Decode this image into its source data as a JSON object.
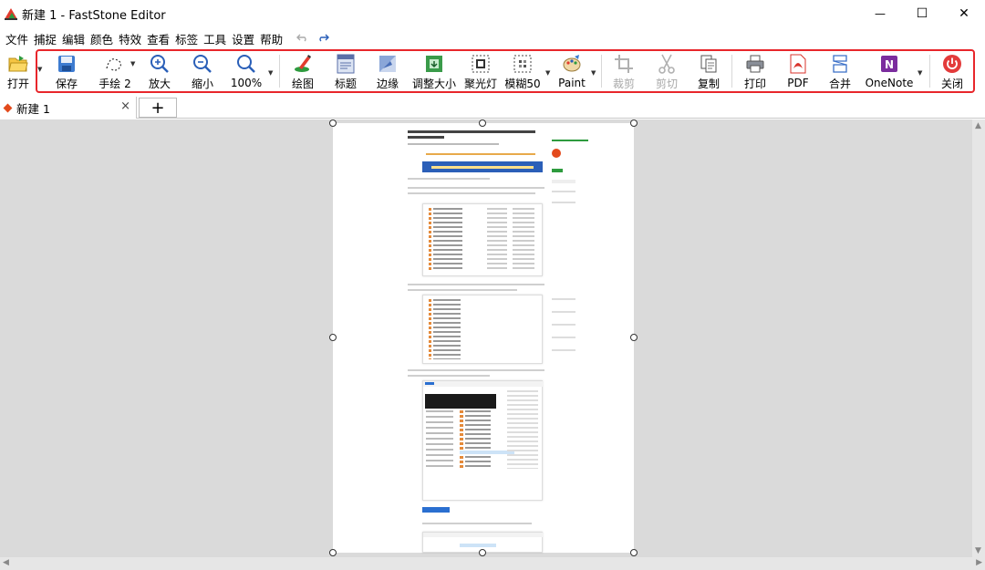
{
  "window": {
    "title": "新建 1 - FastStone Editor",
    "minimize_glyph": "—",
    "maximize_glyph": "☐",
    "close_glyph": "✕"
  },
  "menu": [
    "文件",
    "捕捉",
    "编辑",
    "颜色",
    "特效",
    "查看",
    "标签",
    "工具",
    "设置",
    "帮助"
  ],
  "toolbar": {
    "open": "打开",
    "save": "保存",
    "freehand": "手绘 2",
    "zoom_in": "放大",
    "zoom_out": "缩小",
    "zoom_level": "100%",
    "draw": "绘图",
    "caption": "标题",
    "edge": "边缘",
    "resize": "调整大小",
    "spotlight": "聚光灯",
    "blur": "模糊50",
    "paint": "Paint",
    "crop": "裁剪",
    "cut": "剪切",
    "copy": "复制",
    "print": "打印",
    "pdf": "PDF",
    "merge": "合并",
    "onenote": "OneNote",
    "close": "关闭"
  },
  "tabs": {
    "active": "新建 1",
    "close_glyph": "×",
    "add_glyph": "+"
  },
  "colors": {
    "highlight_border": "#e8262b",
    "accent_blue": "#2b5fb8",
    "disabled_text": "#a8a8a8",
    "workspace_bg": "#dadada"
  }
}
